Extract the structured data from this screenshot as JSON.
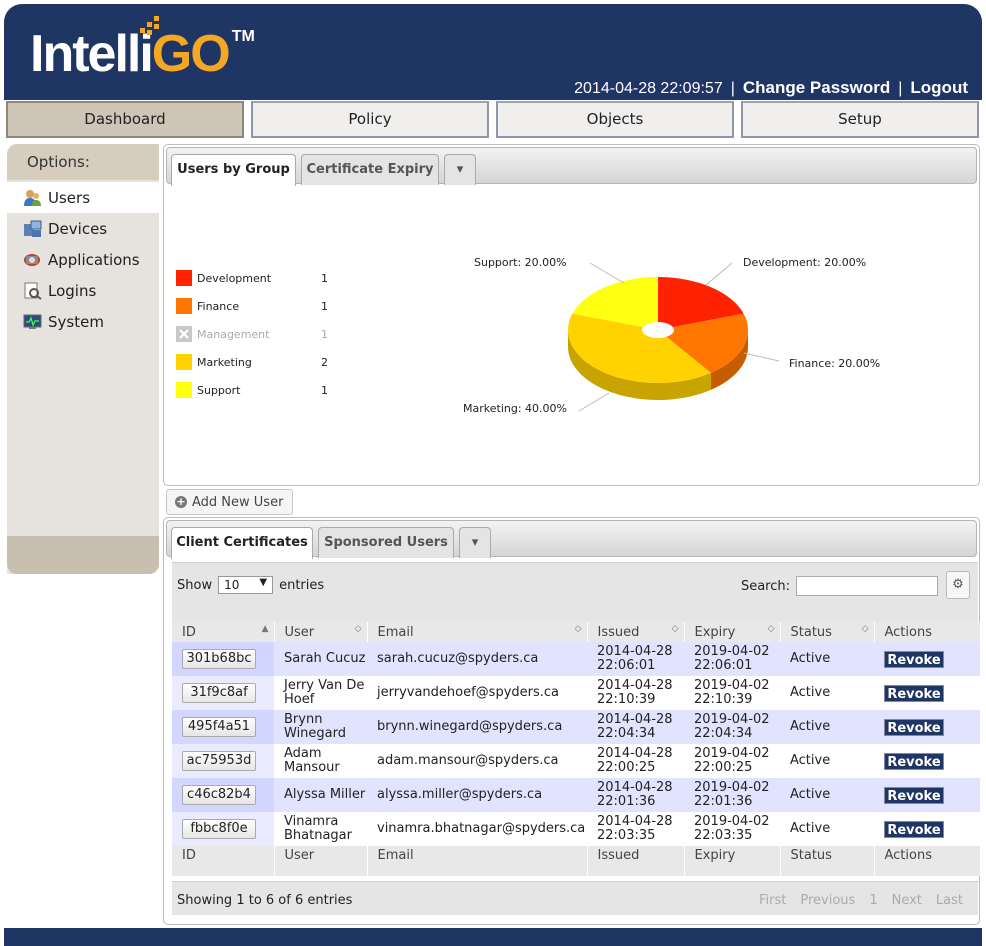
{
  "header": {
    "logo_main": "Intelli",
    "logo_go": "GO",
    "logo_tm": "TM",
    "datetime": "2014-04-28 22:09:57",
    "separator": "|",
    "change_password": "Change Password",
    "logout": "Logout"
  },
  "nav": {
    "tabs": [
      {
        "label": "Dashboard",
        "active": true
      },
      {
        "label": "Policy"
      },
      {
        "label": "Objects"
      },
      {
        "label": "Setup"
      }
    ]
  },
  "sidebar": {
    "heading": "Options:",
    "items": [
      {
        "label": "Users",
        "icon": "users-icon",
        "active": true
      },
      {
        "label": "Devices",
        "icon": "devices-icon"
      },
      {
        "label": "Applications",
        "icon": "applications-icon"
      },
      {
        "label": "Logins",
        "icon": "logins-icon"
      },
      {
        "label": "System",
        "icon": "system-icon"
      }
    ]
  },
  "chart_panel": {
    "tabs": [
      "Users by Group",
      "Certificate Expiry"
    ],
    "menu_caret": "▾"
  },
  "chart_data": {
    "type": "pie",
    "title": "",
    "slices": [
      {
        "label": "Development",
        "count": 1,
        "percent": 20.0,
        "color": "#ff2200"
      },
      {
        "label": "Finance",
        "count": 1,
        "percent": 20.0,
        "color": "#ff7700"
      },
      {
        "label": "Management",
        "count": 1,
        "percent": 0,
        "color": "#c0c0c0",
        "disabled": true
      },
      {
        "label": "Marketing",
        "count": 2,
        "percent": 40.0,
        "color": "#ffd200"
      },
      {
        "label": "Support",
        "count": 1,
        "percent": 20.0,
        "color": "#ffff11"
      }
    ],
    "slice_labels": {
      "support": "Support: 20.00%",
      "development": "Development: 20.00%",
      "finance": "Finance: 20.00%",
      "marketing": "Marketing: 40.00%"
    },
    "legend_placement": "left"
  },
  "add_user": {
    "label": "Add New User"
  },
  "cert_panel": {
    "tabs": [
      "Client Certificates",
      "Sponsored Users"
    ],
    "menu_caret": "▾",
    "show_label": "Show",
    "entries_value": "10",
    "entries_label": "entries",
    "search_label": "Search:",
    "search_value": "",
    "columns": [
      "ID",
      "User",
      "Email",
      "Issued",
      "Expiry",
      "Status",
      "Actions"
    ],
    "rows": [
      {
        "id": "301b68bc",
        "user": "Sarah Cucuz",
        "email": "sarah.cucuz@spyders.ca",
        "issued_date": "2014-04-28",
        "issued_time": "22:06:01",
        "expiry_date": "2019-04-02",
        "expiry_time": "22:06:01",
        "status": "Active",
        "action": "Revoke"
      },
      {
        "id": "31f9c8af",
        "user": "Jerry Van De Hoef",
        "email": "jerryvandehoef@spyders.ca",
        "issued_date": "2014-04-28",
        "issued_time": "22:10:39",
        "expiry_date": "2019-04-02",
        "expiry_time": "22:10:39",
        "status": "Active",
        "action": "Revoke"
      },
      {
        "id": "495f4a51",
        "user": "Brynn Winegard",
        "email": "brynn.winegard@spyders.ca",
        "issued_date": "2014-04-28",
        "issued_time": "22:04:34",
        "expiry_date": "2019-04-02",
        "expiry_time": "22:04:34",
        "status": "Active",
        "action": "Revoke"
      },
      {
        "id": "ac75953d",
        "user": "Adam Mansour",
        "email": "adam.mansour@spyders.ca",
        "issued_date": "2014-04-28",
        "issued_time": "22:00:25",
        "expiry_date": "2019-04-02",
        "expiry_time": "22:00:25",
        "status": "Active",
        "action": "Revoke"
      },
      {
        "id": "c46c82b4",
        "user": "Alyssa Miller",
        "email": "alyssa.miller@spyders.ca",
        "issued_date": "2014-04-28",
        "issued_time": "22:01:36",
        "expiry_date": "2019-04-02",
        "expiry_time": "22:01:36",
        "status": "Active",
        "action": "Revoke"
      },
      {
        "id": "fbbc8f0e",
        "user": "Vinamra Bhatnagar",
        "email": "vinamra.bhatnagar@spyders.ca",
        "issued_date": "2014-04-28",
        "issued_time": "22:03:35",
        "expiry_date": "2019-04-02",
        "expiry_time": "22:03:35",
        "status": "Active",
        "action": "Revoke"
      }
    ],
    "info": "Showing 1 to 6 of 6 entries",
    "paging": [
      "First",
      "Previous",
      "1",
      "Next",
      "Last"
    ]
  },
  "colors": {
    "brand_navy": "#1f3564",
    "brand_orange": "#f5a623"
  }
}
